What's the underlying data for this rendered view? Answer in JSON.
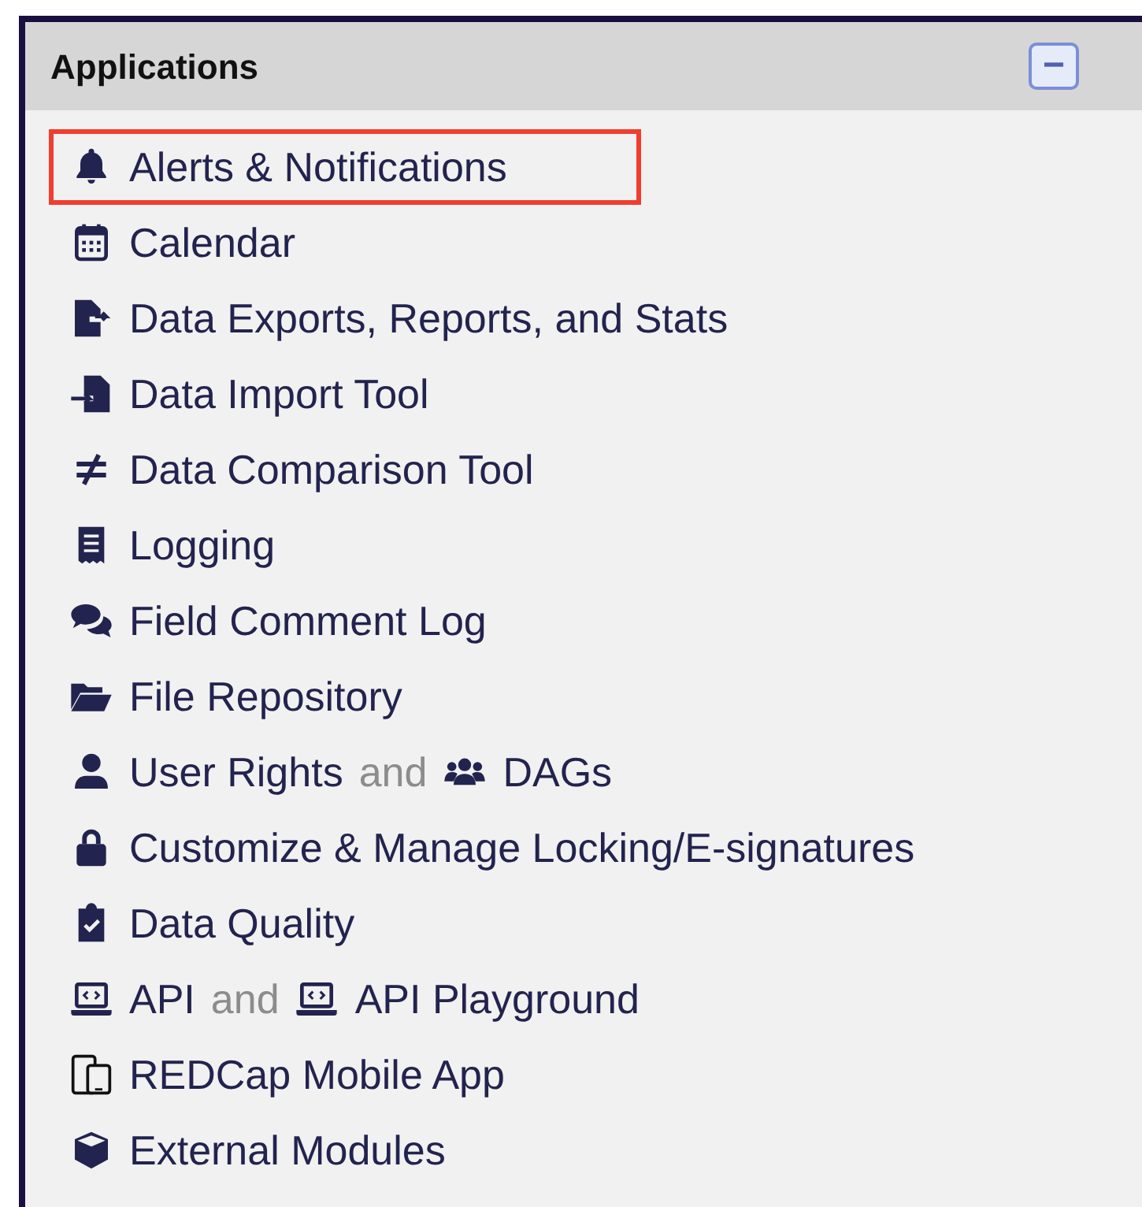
{
  "panel": {
    "title": "Applications",
    "collapse_button": "−"
  },
  "items": [
    {
      "links": [
        "Alerts & Notifications"
      ],
      "highlighted": true
    },
    {
      "links": [
        "Calendar"
      ],
      "highlighted": false
    },
    {
      "links": [
        "Data Exports, Reports, and Stats"
      ],
      "highlighted": false
    },
    {
      "links": [
        "Data Import Tool"
      ],
      "highlighted": false
    },
    {
      "links": [
        "Data Comparison Tool"
      ],
      "highlighted": false
    },
    {
      "links": [
        "Logging"
      ],
      "highlighted": false
    },
    {
      "links": [
        "Field Comment Log"
      ],
      "highlighted": false
    },
    {
      "links": [
        "File Repository"
      ],
      "highlighted": false
    },
    {
      "links": [
        "User Rights",
        "DAGs"
      ],
      "joiner": "and",
      "highlighted": false
    },
    {
      "links": [
        "Customize & Manage Locking/E-signatures"
      ],
      "highlighted": false
    },
    {
      "links": [
        "Data Quality"
      ],
      "highlighted": false
    },
    {
      "links": [
        "API",
        "API Playground"
      ],
      "joiner": "and",
      "highlighted": false
    },
    {
      "links": [
        "REDCap Mobile App"
      ],
      "highlighted": false
    },
    {
      "links": [
        "External Modules"
      ],
      "highlighted": false
    }
  ]
}
